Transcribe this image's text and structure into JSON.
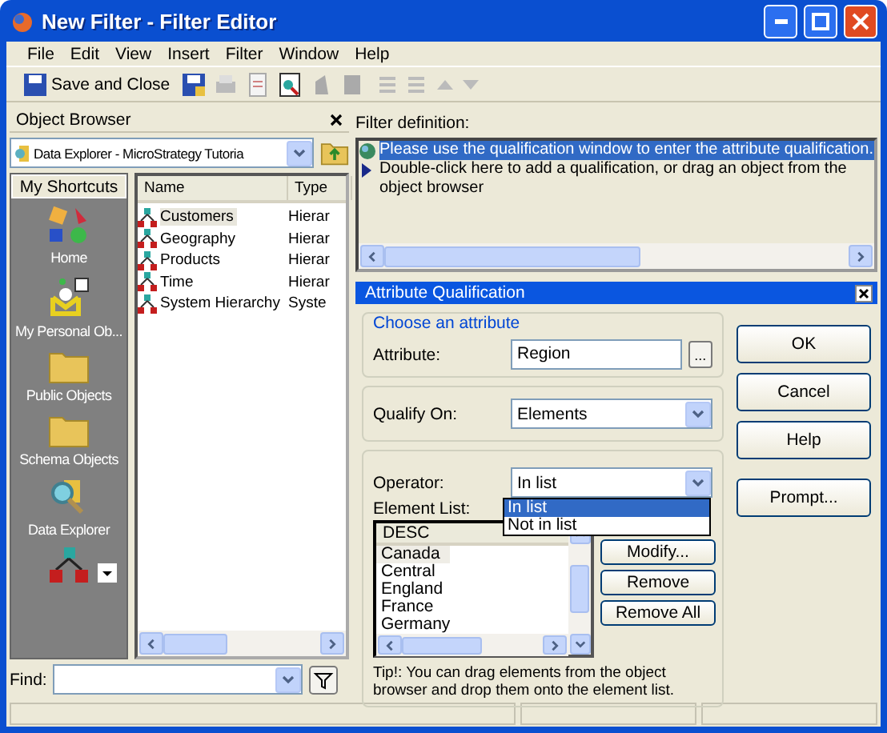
{
  "window": {
    "title": "New Filter - Filter Editor"
  },
  "menu": [
    "File",
    "Edit",
    "View",
    "Insert",
    "Filter",
    "Window",
    "Help"
  ],
  "toolbar": {
    "save_and_close": "Save and Close"
  },
  "object_browser": {
    "title": "Object Browser",
    "source": "Data Explorer - MicroStrategy Tutoria",
    "shortcuts_title": "My Shortcuts",
    "shortcuts": [
      {
        "kind": "home",
        "label": "Home"
      },
      {
        "kind": "personal",
        "label": "My Personal Ob..."
      },
      {
        "kind": "folder",
        "label": "Public Objects"
      },
      {
        "kind": "folder",
        "label": "Schema Objects"
      },
      {
        "kind": "explorer",
        "label": "Data Explorer"
      },
      {
        "kind": "hierarchy"
      }
    ],
    "columns": [
      "Name",
      "Type"
    ],
    "rows": [
      {
        "name": "Customers",
        "type": "Hierar",
        "selected": true
      },
      {
        "name": "Geography",
        "type": "Hierar",
        "selected": false
      },
      {
        "name": "Products",
        "type": "Hierar",
        "selected": false
      },
      {
        "name": "Time",
        "type": "Hierar",
        "selected": false
      },
      {
        "name": "System Hierarchy",
        "type": "Syste",
        "selected": false
      }
    ],
    "find_label": "Find:"
  },
  "filter_definition": {
    "label": "Filter definition:",
    "lines": [
      {
        "kind": "info",
        "text": "Please use the qualification window to enter the attribute qualification.",
        "selected": true
      },
      {
        "kind": "add",
        "text": "Double-click here to add a qualification, or drag an object from the object browser",
        "selected": false
      }
    ]
  },
  "qualification": {
    "title": "Attribute Qualification",
    "group_title": "Choose an attribute",
    "attribute_label": "Attribute:",
    "attribute": "Region",
    "browse": "...",
    "qualify_label": "Qualify On:",
    "qualify_value": "Elements",
    "operator_label": "Operator:",
    "operator_value": "In list",
    "operator_options": [
      {
        "label": "In list",
        "selected": true
      },
      {
        "label": "Not in list",
        "selected": false
      }
    ],
    "element_list_label": "Element List:",
    "element_column": "DESC",
    "elements": [
      {
        "text": "Canada",
        "selected": true
      },
      {
        "text": "Central",
        "selected": false
      },
      {
        "text": "England",
        "selected": false
      },
      {
        "text": "France",
        "selected": false
      },
      {
        "text": "Germany",
        "selected": false
      }
    ],
    "list_buttons": [
      "Modify...",
      "Remove",
      "Remove All"
    ],
    "tip": "Tip!:  You can drag elements from the object browser and drop them onto the element list.",
    "buttons": [
      "OK",
      "Cancel",
      "Help",
      "Prompt..."
    ]
  }
}
